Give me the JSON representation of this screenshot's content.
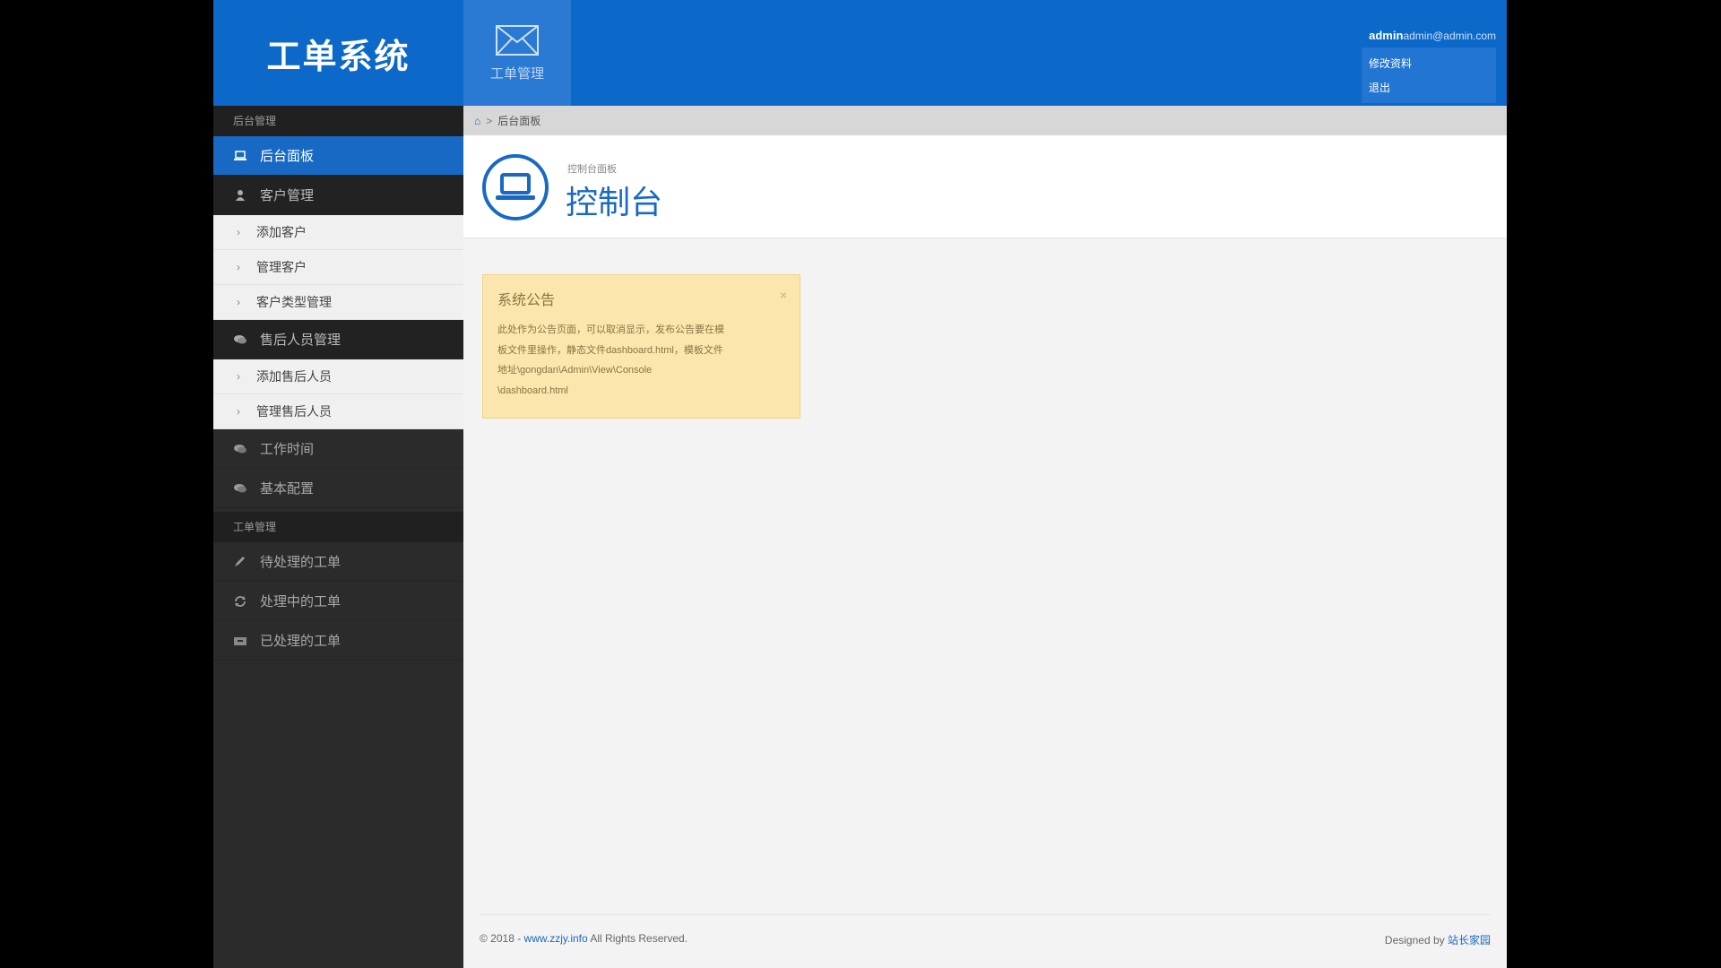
{
  "header": {
    "brand": "工单系统",
    "top_tab": {
      "label": "工单管理",
      "icon": "envelope-icon"
    },
    "user": {
      "name": "admin",
      "email": "admin@admin.com",
      "menu": [
        "修改资料",
        "退出"
      ]
    }
  },
  "sidebar": {
    "section1": "后台管理",
    "dashboard": "后台面板",
    "customer": "客户管理",
    "customer_sub": [
      "添加客户",
      "管理客户",
      "客户类型管理"
    ],
    "aftersales": "售后人员管理",
    "aftersales_sub": [
      "添加售后人员",
      "管理售后人员"
    ],
    "worktime": "工作时间",
    "config": "基本配置",
    "section2": "工单管理",
    "pending": "待处理的工单",
    "processing": "处理中的工单",
    "done": "已处理的工单"
  },
  "breadcrumb": {
    "current": "后台面板"
  },
  "page_header": {
    "subtitle": "控制台面板",
    "title": "控制台"
  },
  "notice": {
    "title": "系统公告",
    "close": "×",
    "lines": [
      "此处作为公告页面，可以取消显示，发布公告要在模",
      "板文件里操作，静态文件dashboard.html，模板文件",
      "地址\\gongdan\\Admin\\View\\Console",
      "\\dashboard.html"
    ]
  },
  "footer": {
    "copyright_prefix": "© 2018 -",
    "site": "www.zzjy.info",
    "rights": "All Rights Reserved.",
    "designed_by": "Designed by",
    "designer": "站长家园"
  },
  "colors": {
    "brand_blue": "#0c68c9",
    "sidebar_dark": "#2b2b2b",
    "notice_bg": "#fbe6ad"
  }
}
